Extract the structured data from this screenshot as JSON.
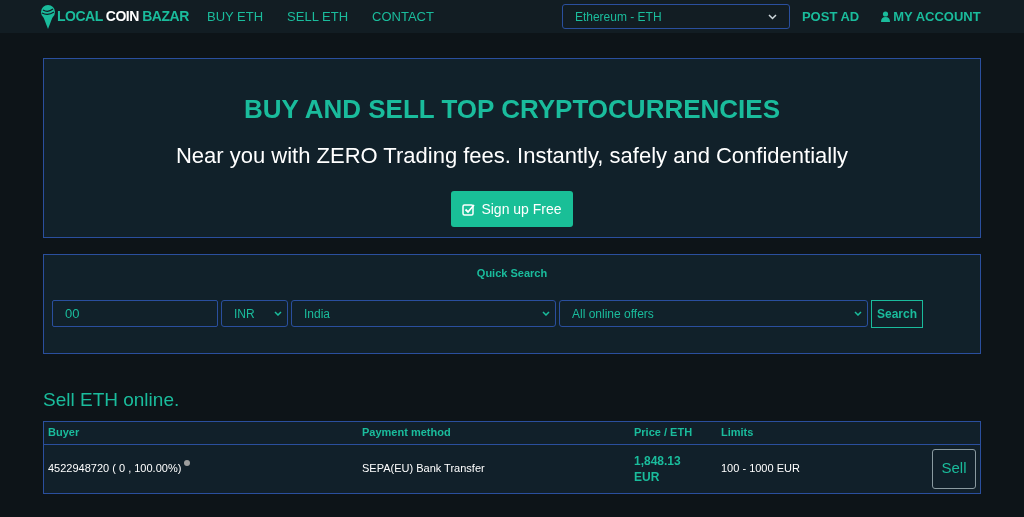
{
  "header": {
    "logo": [
      {
        "text": "LOCAL",
        "accent": true
      },
      {
        "text": "COIN",
        "accent": false
      },
      {
        "text": "BAZAR",
        "accent": true
      }
    ],
    "nav": [
      {
        "label": "BUY ETH"
      },
      {
        "label": "SELL ETH"
      },
      {
        "label": "CONTACT"
      }
    ],
    "currency_select": {
      "value": "Ethereum - ETH"
    },
    "right_links": [
      {
        "label": "POST AD",
        "kind": "plain"
      },
      {
        "label": "MY ACCOUNT",
        "kind": "account"
      }
    ]
  },
  "hero": {
    "title": "BUY AND SELL TOP CRYPTOCURRENCIES",
    "subtitle": "Near you with ZERO Trading fees. Instantly, safely and Confidentially",
    "button": "Sign up Free"
  },
  "quick_search": {
    "title": "Quick Search",
    "amount": {
      "value": "00"
    },
    "currency": {
      "value": "INR"
    },
    "country": {
      "value": "India"
    },
    "offer_type": {
      "value": "All online offers"
    },
    "button": "Search"
  },
  "offers": {
    "heading": "Sell ETH online.",
    "columns": [
      "Buyer",
      "Payment method",
      "Price / ETH",
      "Limits"
    ],
    "rows": [
      {
        "buyer": "4522948720 ( 0 , 100.00%)",
        "online": false,
        "payment": "SEPA(EU) Bank Transfer",
        "price": "1,848.13",
        "price_currency": "EUR",
        "limits": "100 - 1000 EUR",
        "button": "Sell"
      }
    ]
  }
}
